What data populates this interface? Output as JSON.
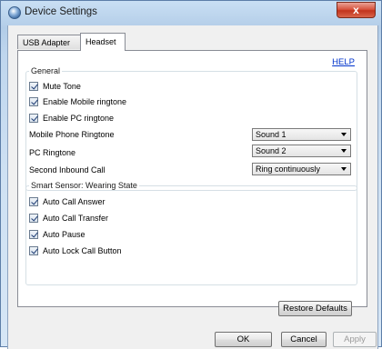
{
  "window": {
    "title": "Device Settings",
    "close_symbol": "x",
    "accent_colors": {
      "close": "#c2341d",
      "link": "#0033cc"
    }
  },
  "tabs": [
    {
      "label": "USB Adapter",
      "selected": false
    },
    {
      "label": "Headset",
      "selected": true
    }
  ],
  "help_link": "HELP",
  "general": {
    "label": "General",
    "checkboxes": [
      {
        "label": "Mute Tone",
        "checked": true
      },
      {
        "label": "Enable Mobile ringtone",
        "checked": true
      },
      {
        "label": "Enable PC ringtone",
        "checked": true
      }
    ],
    "fields": [
      {
        "label": "Mobile Phone Ringtone",
        "value": "Sound 1"
      },
      {
        "label": "PC Ringtone",
        "value": "Sound 2"
      },
      {
        "label": "Second Inbound Call",
        "value": "Ring continuously"
      }
    ]
  },
  "sensor": {
    "label": "Smart Sensor: Wearing State",
    "checkboxes": [
      {
        "label": "Auto Call Answer",
        "checked": true
      },
      {
        "label": "Auto Call Transfer",
        "checked": true
      },
      {
        "label": "Auto Pause",
        "checked": true
      },
      {
        "label": "Auto Lock Call Button",
        "checked": true
      }
    ]
  },
  "buttons": {
    "restore_defaults": "Restore Defaults",
    "ok": "OK",
    "cancel": "Cancel",
    "apply": "Apply"
  }
}
